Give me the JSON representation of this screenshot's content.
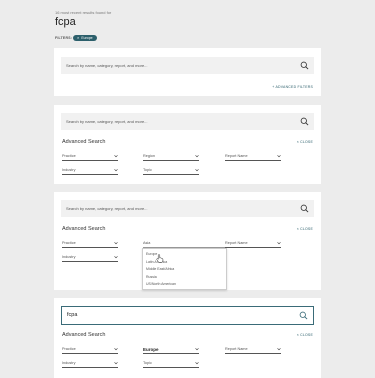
{
  "header": {
    "results_text": "16 most recent results found for",
    "query_title": "fcpa",
    "filters_label": "FILTERS:",
    "active_filter": "Europe"
  },
  "search": {
    "placeholder": "Search by name, category, report, and more...",
    "typed_value": "fcpa"
  },
  "panel1": {
    "advanced_filters_label": "+ ADVANCED FILTERS"
  },
  "advanced": {
    "title": "Advanced Search",
    "close_label": "× CLOSE",
    "practice": "Practice",
    "region": "Region",
    "report_name": "Report Name",
    "industry": "Industry",
    "topic": "Topic",
    "region_open_value": "Asia",
    "region_selected": "Europe"
  },
  "region_dropdown": {
    "options": [
      "Europe",
      "Latin America",
      "Middle East/Africa",
      "Russia",
      "US/North American"
    ]
  },
  "colors": {
    "accent": "#2c5f6b",
    "panel_bg": "#ffffff",
    "page_bg": "#ececec"
  }
}
